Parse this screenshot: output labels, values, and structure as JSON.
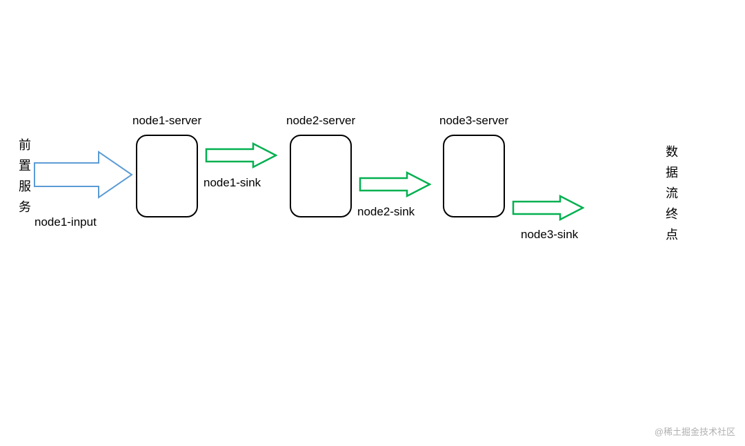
{
  "leftLabel": "前置服务",
  "rightLabel": "数据流终点",
  "inputLabel": "node1-input",
  "nodes": [
    {
      "server": "node1-server",
      "sink": "node1-sink"
    },
    {
      "server": "node2-server",
      "sink": "node2-sink"
    },
    {
      "server": "node3-server",
      "sink": "node3-sink"
    }
  ],
  "watermark": "@稀土掘金技术社区",
  "colors": {
    "inputArrowStroke": "#5b9bd5",
    "inputArrowFill": "#ffffff",
    "flowArrowStroke": "#00b050",
    "flowArrowFill": "#ffffff",
    "boxStroke": "#000000"
  },
  "chart_data": {
    "type": "flow",
    "description": "Data flow pipeline from front-end service through three server nodes to data stream endpoint",
    "nodes": [
      {
        "id": "front",
        "label": "前置服务",
        "type": "source"
      },
      {
        "id": "n1",
        "label": "node1-server",
        "type": "processor"
      },
      {
        "id": "n2",
        "label": "node2-server",
        "type": "processor"
      },
      {
        "id": "n3",
        "label": "node3-server",
        "type": "processor"
      },
      {
        "id": "end",
        "label": "数据流终点",
        "type": "sink"
      }
    ],
    "edges": [
      {
        "from": "front",
        "to": "n1",
        "label": "node1-input"
      },
      {
        "from": "n1",
        "to": "n2",
        "label": "node1-sink"
      },
      {
        "from": "n2",
        "to": "n3",
        "label": "node2-sink"
      },
      {
        "from": "n3",
        "to": "end",
        "label": "node3-sink"
      }
    ]
  }
}
